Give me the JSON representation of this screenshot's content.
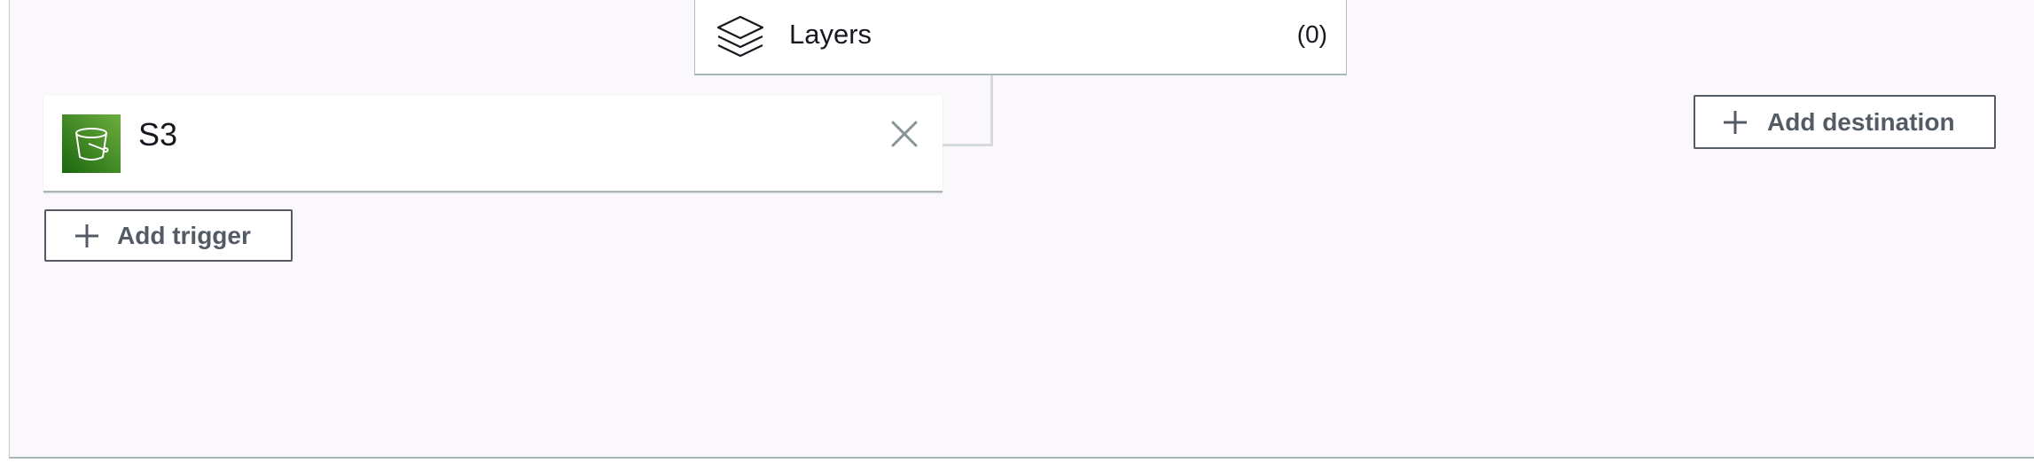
{
  "layers": {
    "label": "Layers",
    "count": "(0)",
    "icon": "layers-icon"
  },
  "trigger": {
    "service_label": "S3",
    "icon": "s3-bucket-icon",
    "remove_icon": "close-icon"
  },
  "buttons": {
    "add_trigger": "Add trigger",
    "add_destination": "Add destination"
  },
  "colors": {
    "s3_brand_dark": "#1b660f",
    "s3_brand_light": "#6cae3e",
    "button_text": "#545b64",
    "selected_accent": "#0b6f9c",
    "panel_background": "#faf8fb"
  }
}
